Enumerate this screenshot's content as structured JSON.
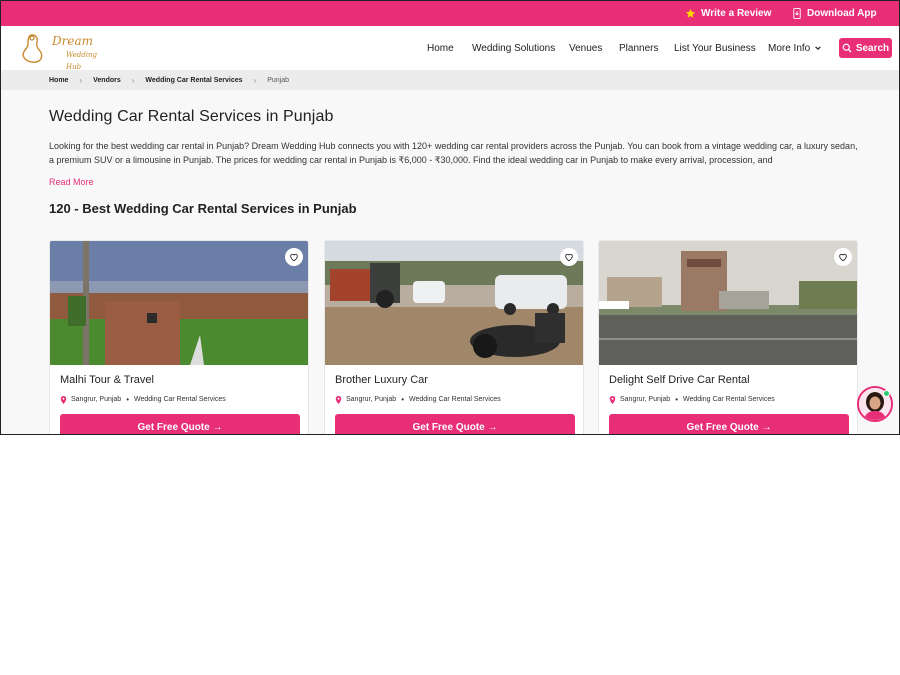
{
  "topbar": {
    "review_label": "Write a Review",
    "app_label": "Download App",
    "accent": "#e72e77",
    "star_color": "#ffd400"
  },
  "header": {
    "logo_name": "Dream",
    "logo_sub": "Wedding Hub",
    "nav": [
      "Home",
      "Wedding Solutions",
      "Venues",
      "Planners",
      "List Your Business",
      "More Info"
    ],
    "search_label": "Search"
  },
  "breadcrumb": [
    "Home",
    "Vendors",
    "Wedding Car Rental Services",
    "Punjab"
  ],
  "main": {
    "title": "Wedding Car Rental Services in Punjab",
    "intro": "Looking for the best wedding car rental in Punjab? Dream Wedding Hub connects you with 120+ wedding car rental providers across the Punjab. You can book from a vintage wedding car, a luxury sedan, a premium SUV or a limousine in Punjab. The prices for wedding car rental in Punjab is ₹6,000 - ₹30,000. Find the ideal wedding car in Punjab to make every arrival, procession, and",
    "read_more": "Read More",
    "count_title": "120 - Best Wedding Car Rental Services in Punjab"
  },
  "cards": [
    {
      "name": "Malhi Tour & Travel",
      "location": "Sangrur, Punjab",
      "category": "Wedding Car Rental Services",
      "cta": "Get Free Quote →"
    },
    {
      "name": "Brother Luxury Car",
      "location": "Sangrur, Punjab",
      "category": "Wedding Car Rental Services",
      "cta": "Get Free Quote →"
    },
    {
      "name": "Delight Self Drive Car Rental",
      "location": "Sangrur, Punjab",
      "category": "Wedding Car Rental Services",
      "cta": "Get Free Quote →"
    }
  ],
  "icons": {
    "review": "star-icon",
    "app": "phone-download-icon",
    "search": "search-icon",
    "more": "chevron-down-icon",
    "favorite": "heart-icon",
    "location": "location-pin-icon",
    "chat": "chat-avatar-icon"
  }
}
